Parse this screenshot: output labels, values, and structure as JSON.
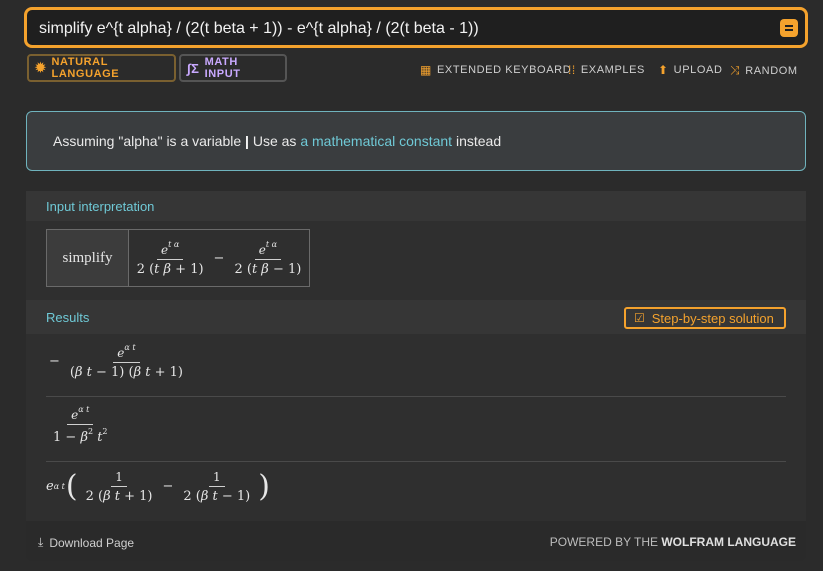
{
  "search": {
    "query": "simplify e^{t alpha} / (2(t beta + 1)) - e^{t alpha} / (2(t beta - 1))"
  },
  "modes": {
    "natural_language": "NATURAL LANGUAGE",
    "math_input": "MATH INPUT"
  },
  "tools": {
    "extended_keyboard": "EXTENDED KEYBOARD",
    "examples": "EXAMPLES",
    "upload": "UPLOAD",
    "random": "RANDOM"
  },
  "assumption": {
    "prefix": "Assuming \"alpha\" is a variable",
    "separator": "|",
    "use_as": "Use as",
    "link": "a mathematical constant",
    "suffix": "instead"
  },
  "interpretation": {
    "title": "Input interpretation",
    "command": "simplify"
  },
  "results": {
    "title": "Results",
    "step_button": "Step-by-step solution"
  },
  "footer": {
    "download": "Download Page",
    "powered_prefix": "POWERED BY THE",
    "powered_brand": "WOLFRAM LANGUAGE"
  },
  "colors": {
    "accent": "#f4a22d",
    "link": "#6fc9d6",
    "math_input": "#c9a9ff"
  },
  "icons": {
    "natural_language": "gear-icon",
    "math_input": "sigma-icon",
    "keyboard": "keyboard-icon",
    "examples": "grid-icon",
    "upload": "upload-icon",
    "random": "shuffle-icon",
    "step": "checkbox-icon",
    "download": "download-icon",
    "go": "menu-icon"
  }
}
